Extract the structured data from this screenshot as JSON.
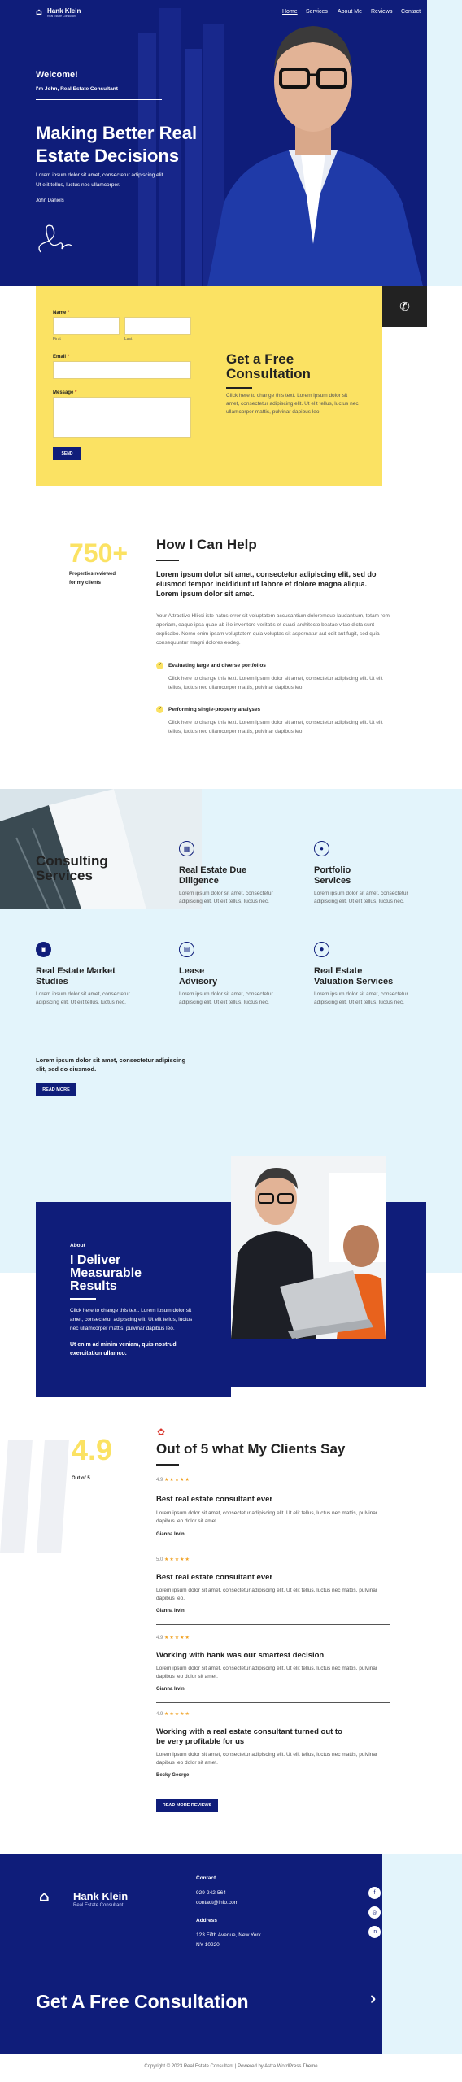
{
  "brand": {
    "name": "Hank Klein",
    "tagline": "Real Estate Consultant"
  },
  "nav": {
    "items": [
      "Home",
      "Services",
      "About Me",
      "Reviews",
      "Contact"
    ]
  },
  "hero": {
    "welcome": "Welcome!",
    "intro": "I'm John, Real Estate Consultant",
    "heading_line1": "Making Better Real",
    "heading_line2": "Estate Decisions",
    "body_line1": "Lorem ipsum dolor sit amet, consectetur adipiscing elit.",
    "body_line2": "Ut elit tellus, luctus nec ullamcorper.",
    "signature_name": "John Daniels"
  },
  "form": {
    "name_label": "Name",
    "first_label": "First",
    "last_label": "Last",
    "email_label": "Email",
    "message_label": "Message",
    "required_mark": "*",
    "submit_label": "SEND",
    "title_line1": "Get a Free",
    "title_line2": "Consultation",
    "body": "Click here to change this text. Lorem ipsum dolor sit amet, consectetur adipiscing elit. Ut elit tellus, luctus nec ullamcorper mattis, pulvinar dapibus leo."
  },
  "how": {
    "stat_value": "750+",
    "stat_label_line1": "Properties reviewed",
    "stat_label_line2": "for my clients",
    "title": "How I Can Help",
    "lead": "Lorem ipsum dolor sit amet, consectetur adipiscing elit, sed do eiusmod tempor incididunt ut labore et dolore magna aliqua. Lorem ipsum dolor sit amet.",
    "body": "Your Attractive Hliksi iste natus error sit voluptatem accusantium doloremque laudantium, totam rem aperiam, eaque ipsa quae ab illo inventore veritatis et quasi architecto beatae vitae dicta sunt explicabo. Nemo enim ipsam voluptatem quia voluptas sit aspernatur aut odit aut fugit, sed quia consequuntur magni dolores eodeg.",
    "points": [
      {
        "title": "Evaluating large and diverse portfolios",
        "text": "Click here to change this text. Lorem ipsum dolor sit amet, consectetur adipiscing elit. Ut elit tellus, luctus nec ullamcorper mattis, pulvinar dapibus leo."
      },
      {
        "title": "Performing single-property analyses",
        "text": "Click here to change this text. Lorem ipsum dolor sit amet, consectetur adipiscing elit. Ut elit tellus, luctus nec ullamcorper mattis, pulvinar dapibus leo."
      }
    ]
  },
  "services": {
    "heading_line1": "Consulting",
    "heading_line2": "Services",
    "items": [
      {
        "title_line1": "Real Estate Due",
        "title_line2": "Diligence",
        "text": "Lorem ipsum dolor sit amet, consectetur adipiscing elit. Ut elit tellus, luctus nec."
      },
      {
        "title_line1": "Portfolio",
        "title_line2": "Services",
        "text": "Lorem ipsum dolor sit amet, consectetur adipiscing elit. Ut elit tellus, luctus nec."
      },
      {
        "title_line1": "Real Estate Market",
        "title_line2": "Studies",
        "text": "Lorem ipsum dolor sit amet, consectetur adipiscing elit. Ut elit tellus, luctus nec."
      },
      {
        "title_line1": "Lease",
        "title_line2": "Advisory",
        "text": "Lorem ipsum dolor sit amet, consectetur adipiscing elit. Ut elit tellus, luctus nec."
      },
      {
        "title_line1": "Real Estate",
        "title_line2": "Valuation Services",
        "text": "Lorem ipsum dolor sit amet, consectetur adipiscing elit. Ut elit tellus, luctus nec."
      }
    ],
    "closing": "Lorem ipsum dolor sit amet, consectetur adipiscing elit, sed do eiusmod.",
    "read_more": "READ MORE"
  },
  "about": {
    "kicker": "About",
    "title_line1": "I Deliver",
    "title_line2": "Measurable",
    "title_line3": "Results",
    "body": "Click here to change this text. Lorem ipsum dolor sit amet, consectetur adipiscing elit. Ut elit tellus, luctus nec ullamcorper mattis, pulvinar dapibus leo.",
    "bold": "Ut enim ad minim veniam, quis nostrud exercitation ullamco."
  },
  "reviews": {
    "score": "4.9",
    "score_label": "Out of 5",
    "title": "Out of 5 what My Clients Say",
    "items": [
      {
        "rating": "4.9",
        "stars": "★★★★★",
        "title": "Best real estate consultant ever",
        "text": "Lorem ipsum dolor sit amet, consectetur adipiscing elit. Ut elit tellus, luctus nec mattis, pulvinar dapibus leo dolor sit amet.",
        "author": "Gianna Irvin"
      },
      {
        "rating": "5.0",
        "stars": "★★★★★",
        "title": "Best real estate consultant ever",
        "text": "Lorem ipsum dolor sit amet, consectetur adipiscing elit. Ut elit tellus, luctus nec mattis, pulvinar dapibus leo.",
        "author": "Gianna Irvin"
      },
      {
        "rating": "4.9",
        "stars": "★★★★★",
        "title": "Working with hank was our smartest decision",
        "text": "Lorem ipsum dolor sit amet, consectetur adipiscing elit. Ut elit tellus, luctus nec mattis, pulvinar dapibus leo dolor sit amet.",
        "author": "Gianna Irvin"
      },
      {
        "rating": "4.9",
        "stars": "★★★★★",
        "title_line1": "Working with a real estate consultant turned out to",
        "title_line2": "be very profitable for us",
        "text": "Lorem ipsum dolor sit amet, consectetur adipiscing elit. Ut elit tellus, luctus nec mattis, pulvinar dapibus leo dolor sit amet.",
        "author": "Becky George"
      }
    ],
    "button": "READ MORE REVIEWS"
  },
  "footer": {
    "contact_heading": "Contact",
    "phone": "929-242-564",
    "email": "contact@info.com",
    "address_heading": "Address",
    "address_line1": "123 Fifth Avenue, New York",
    "address_line2": "NY 10220",
    "cta": "Get A Free Consultation",
    "copyright": "Copyright © 2023 Real Estate Consultant | Powered by Astra WordPress Theme"
  },
  "colors": {
    "navy": "#0f1d7a",
    "yellow": "#fbe263",
    "light_blue": "#e3f4fb",
    "dark": "#222222"
  }
}
